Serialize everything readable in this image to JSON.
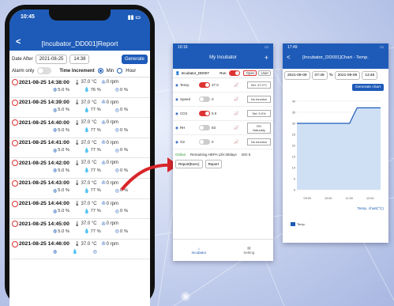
{
  "phone": {
    "status_time": "10:45",
    "title": "[Incubator_DD001]Report",
    "filter": {
      "label": "Date After",
      "date": "2021-08-25",
      "time": "14:38",
      "generate_label": "Generate"
    },
    "options": {
      "alarm_label": "Alarm only",
      "increment_label": "Time Increment",
      "min_label": "Min",
      "hour_label": "Hour"
    },
    "records": [
      {
        "ts": "2021-08-25 14:38:00",
        "temp": "37.0 °C",
        "rpm": "0 rpm",
        "co2": "5.0 %",
        "rh": "76 %",
        "o2": "0 %"
      },
      {
        "ts": "2021-08-25 14:39:00",
        "temp": "37.0 °C",
        "rpm": "0 rpm",
        "co2": "5.0 %",
        "rh": "77 %",
        "o2": "0 %"
      },
      {
        "ts": "2021-08-25 14:40:00",
        "temp": "37.0 °C",
        "rpm": "0 rpm",
        "co2": "5.0 %",
        "rh": "77 %",
        "o2": "0 %"
      },
      {
        "ts": "2021-08-25 14:41:00",
        "temp": "37.0 °C",
        "rpm": "0 rpm",
        "co2": "5.0 %",
        "rh": "77 %",
        "o2": "0 %"
      },
      {
        "ts": "2021-08-25 14:42:00",
        "temp": "37.0 °C",
        "rpm": "0 rpm",
        "co2": "5.0 %",
        "rh": "77 %",
        "o2": "0 %"
      },
      {
        "ts": "2021-08-25 14:43:00",
        "temp": "37.0 °C",
        "rpm": "0 rpm",
        "co2": "5.0 %",
        "rh": "77 %",
        "o2": "0 %"
      },
      {
        "ts": "2021-08-25 14:44:00",
        "temp": "37.0 °C",
        "rpm": "0 rpm",
        "co2": "5.0 %",
        "rh": "77 %",
        "o2": "0 %"
      },
      {
        "ts": "2021-08-25 14:45:00",
        "temp": "37.0 °C",
        "rpm": "0 rpm",
        "co2": "5.0 %",
        "rh": "77 %",
        "o2": "0 %"
      },
      {
        "ts": "2021-08-25 14:46:00",
        "temp": "37.0 °C",
        "rpm": "0 rpm",
        "co2": "",
        "rh": "",
        "o2": ""
      }
    ]
  },
  "incubator": {
    "status_time": "10:16",
    "title": "My Incubator",
    "device": "Incubator_DD007",
    "run_label": "Run",
    "open_label": "Open",
    "user_label": "User",
    "params": [
      {
        "name": "Temp.",
        "value": "37.0",
        "on": true,
        "set": "Set: 37.0°C"
      },
      {
        "name": "Speed",
        "value": "0",
        "on": false,
        "set": "No function"
      },
      {
        "name": "CO2",
        "value": "5.0",
        "on": true,
        "set": "Set: 5.0%"
      },
      {
        "name": "RH",
        "value": "83",
        "on": false,
        "set": "RH Naturally"
      },
      {
        "name": "O2",
        "value": "0",
        "on": false,
        "set": "No function"
      }
    ],
    "online": "Online",
    "hepa": "Remaining HEPA Life:30days",
    "iso": "ISO 5",
    "btn_report_excel": "Report(Exec)",
    "btn_report": "Report",
    "tab_incubator": "Incubator",
    "tab_setting": "Setting"
  },
  "chart_screen": {
    "status_time": "17:49",
    "title": "[Incubator_DD001]Chart - Temp.",
    "from_date": "2021-09-09",
    "from_time": "07:49",
    "to_label": "To",
    "to_date": "2021-09-09",
    "to_time": "13:48",
    "generate_label": "Generate chart",
    "legend": "Temp.",
    "chart_title": "Temp. chart(°C)"
  },
  "chart_data": {
    "type": "area",
    "title": "Temp. chart(°C)",
    "ylim": [
      0,
      40
    ],
    "yticks": [
      0,
      5,
      10,
      15,
      20,
      25,
      30,
      35,
      40
    ],
    "xticks": [
      "09:00",
      "10:00",
      "11:00",
      "12:00"
    ],
    "x": [
      0,
      0.55,
      0.63,
      0.68,
      0.72,
      1.0
    ],
    "series": [
      {
        "name": "Temp.",
        "values": [
          30,
          30,
          30,
          34,
          37,
          37
        ]
      }
    ],
    "grid": true,
    "legend": "bottom-left",
    "color": "#1e5bb8"
  }
}
